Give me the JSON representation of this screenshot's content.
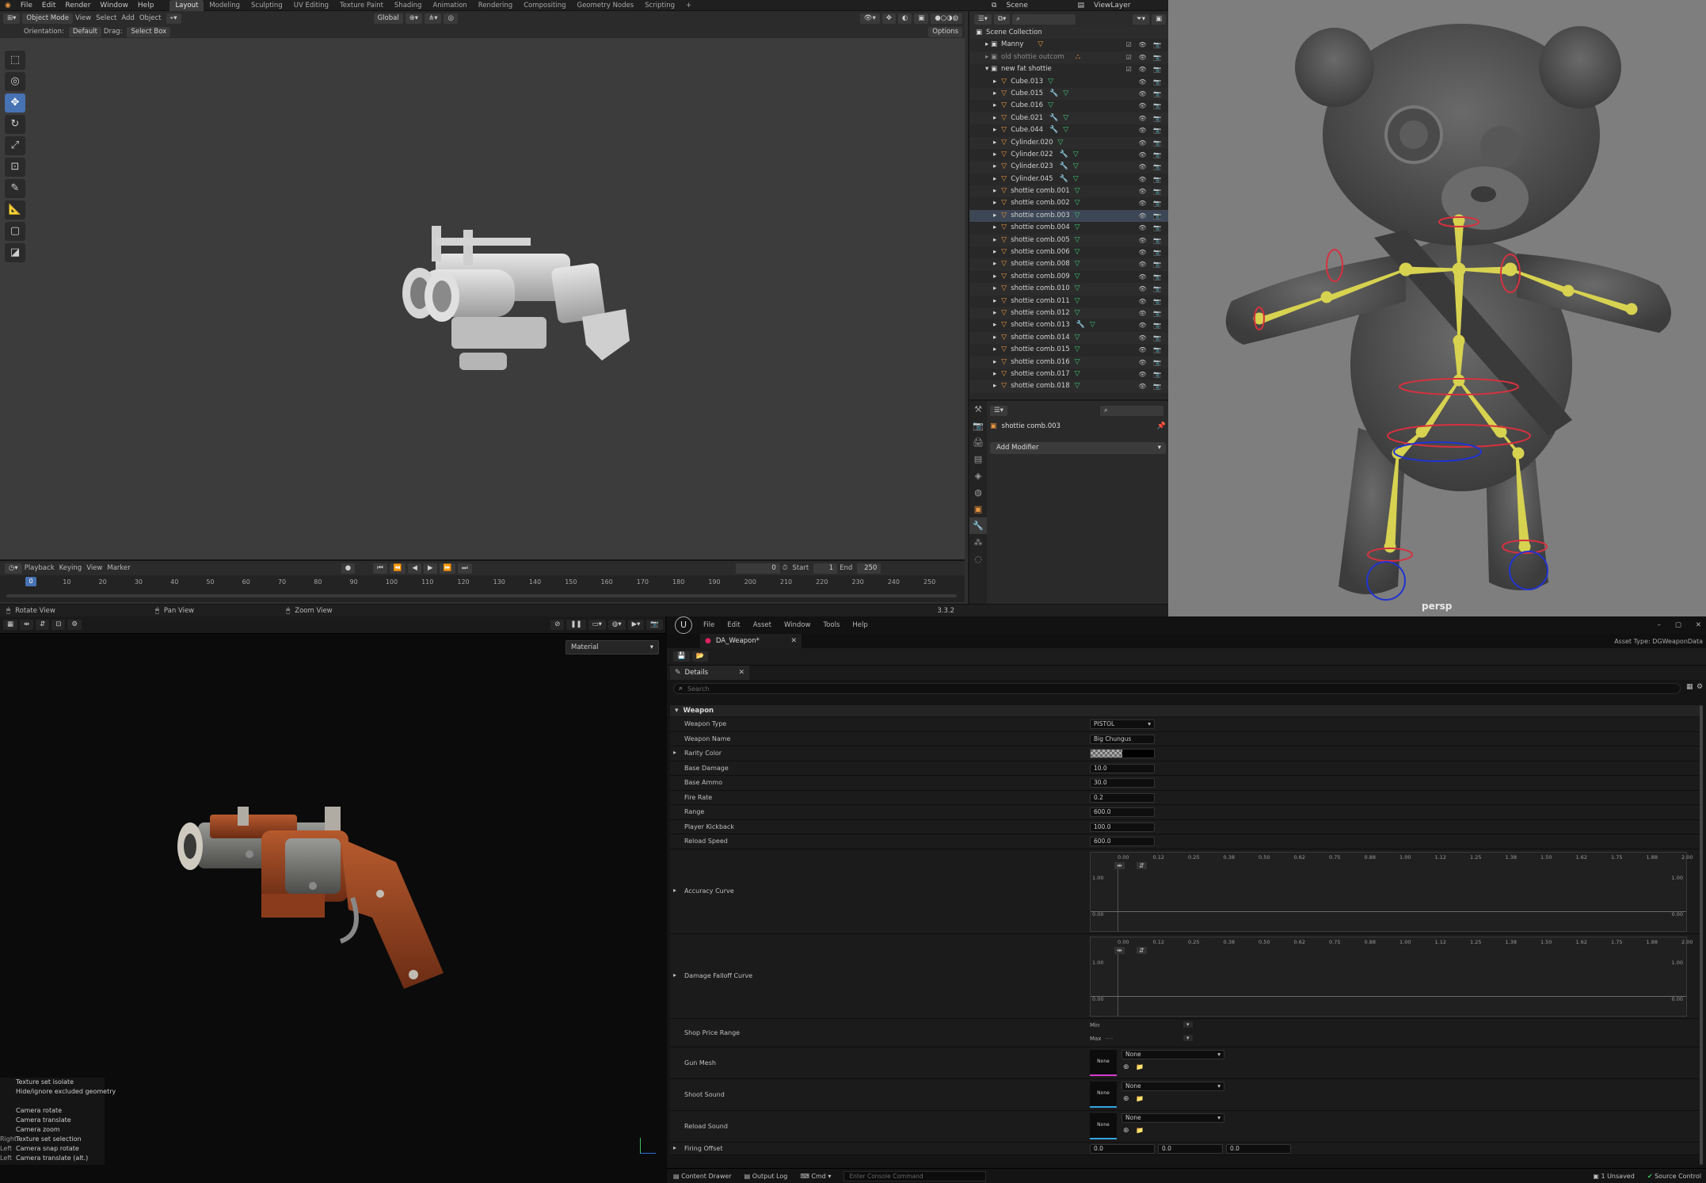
{
  "blender": {
    "menu": [
      "File",
      "Edit",
      "Render",
      "Window",
      "Help"
    ],
    "workspaces": [
      "Layout",
      "Modeling",
      "Sculpting",
      "UV Editing",
      "Texture Paint",
      "Shading",
      "Animation",
      "Rendering",
      "Compositing",
      "Geometry Nodes",
      "Scripting"
    ],
    "active_workspace": "Layout",
    "scene": "Scene",
    "view_layer": "ViewLayer",
    "header": {
      "mode": "Object Mode",
      "view": "View",
      "select": "Select",
      "add": "Add",
      "object": "Object",
      "transform": "Global"
    },
    "header2": {
      "orientation_label": "Orientation:",
      "orientation": "Default",
      "drag_label": "Drag:",
      "drag": "Select Box",
      "options": "Options"
    },
    "outliner": {
      "root": "Scene Collection",
      "collections": [
        "Manny",
        "old shottie outcom",
        "new fat shottie"
      ],
      "items": [
        "Cube.013",
        "Cube.015",
        "Cube.016",
        "Cube.021",
        "Cube.044",
        "Cylinder.020",
        "Cylinder.022",
        "Cylinder.023",
        "Cylinder.045",
        "shottie comb.001",
        "shottie comb.002",
        "shottie comb.003",
        "shottie comb.004",
        "shottie comb.005",
        "shottie comb.006",
        "shottie comb.008",
        "shottie comb.009",
        "shottie comb.010",
        "shottie comb.011",
        "shottie comb.012",
        "shottie comb.013",
        "shottie comb.014",
        "shottie comb.015",
        "shottie comb.016",
        "shottie comb.017",
        "shottie comb.018"
      ]
    },
    "properties": {
      "object": "shottie comb.003",
      "add_modifier": "Add Modifier"
    },
    "timeline": {
      "menu": [
        "Playback",
        "Keying",
        "View",
        "Marker"
      ],
      "current": "0",
      "start_label": "Start",
      "start": "1",
      "end_label": "End",
      "end": "250",
      "ticks": [
        "0",
        "10",
        "20",
        "30",
        "40",
        "50",
        "60",
        "70",
        "80",
        "90",
        "100",
        "110",
        "120",
        "130",
        "140",
        "150",
        "160",
        "170",
        "180",
        "190",
        "200",
        "210",
        "220",
        "230",
        "240",
        "250"
      ]
    },
    "status": {
      "rotate": "Rotate View",
      "pan": "Pan View",
      "zoom": "Zoom View",
      "version": "3.3.2"
    }
  },
  "maya": {
    "camera": "persp"
  },
  "substance": {
    "material": "Material",
    "help": [
      "Texture set isolate",
      "Hide/ignore excluded geometry",
      "",
      "Camera rotate",
      "Camera translate",
      "Camera zoom",
      "Texture set selection",
      "Camera snap rotate",
      "Camera translate (alt.)"
    ],
    "help_keys": [
      "",
      "",
      "",
      "",
      "",
      "",
      "Right",
      "Left",
      "Left"
    ]
  },
  "unreal": {
    "menu": [
      "File",
      "Edit",
      "Asset",
      "Window",
      "Tools",
      "Help"
    ],
    "asset_tab": "DA_Weapon*",
    "asset_type": "Asset Type: DGWeaponData",
    "details": "Details",
    "search": "Search",
    "category": "Weapon",
    "props": [
      {
        "label": "Weapon Type",
        "value": "PISTOL"
      },
      {
        "label": "Weapon Name",
        "value": "Big Chungus"
      },
      {
        "label": "Rarity Color",
        "value": ""
      },
      {
        "label": "Base Damage",
        "value": "10.0"
      },
      {
        "label": "Base Ammo",
        "value": "30.0"
      },
      {
        "label": "Fire Rate",
        "value": "0.2"
      },
      {
        "label": "Range",
        "value": "600.0"
      },
      {
        "label": "Player Kickback",
        "value": "100.0"
      },
      {
        "label": "Reload Speed",
        "value": "600.0"
      }
    ],
    "curve_labels": [
      "Accuracy Curve",
      "Damage Falloff Curve"
    ],
    "curve_ticks": [
      "0.00",
      "0.12",
      "0.25",
      "0.38",
      "0.50",
      "0.62",
      "0.75",
      "0.88",
      "1.00",
      "1.12",
      "1.25",
      "1.38",
      "1.50",
      "1.62",
      "1.75",
      "1.88",
      "2.00"
    ],
    "curve_y": [
      "1.00",
      "0.00"
    ],
    "shop_price": {
      "label": "Shop Price Range",
      "min": "Min",
      "max": "Max",
      "max_value": "----"
    },
    "assets": [
      {
        "label": "Gun Mesh",
        "thumb": "None",
        "value": "None"
      },
      {
        "label": "Shoot Sound",
        "thumb": "None",
        "value": "None"
      },
      {
        "label": "Reload Sound",
        "thumb": "None",
        "value": "None"
      }
    ],
    "firing_offset": {
      "label": "Firing Offset",
      "x": "0.0",
      "y": "0.0",
      "z": "0.0"
    },
    "bottom": {
      "content_drawer": "Content Drawer",
      "output_log": "Output Log",
      "cmd": "Cmd",
      "console": "Enter Console Command",
      "unsaved": "1 Unsaved",
      "source_control": "Source Control"
    }
  }
}
